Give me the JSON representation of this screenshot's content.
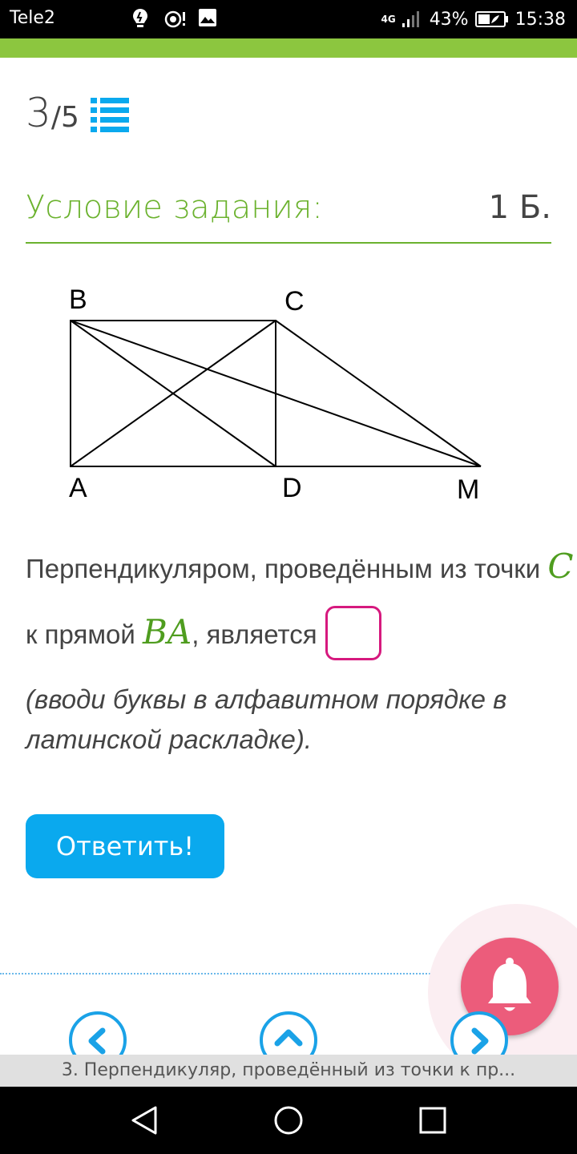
{
  "status_bar": {
    "carrier": "Tele2",
    "network": "4G",
    "battery": "43%",
    "time": "15:38"
  },
  "progress": {
    "current": "3",
    "total": "/5"
  },
  "condition": {
    "title": "Условие задания:",
    "points": "1 Б."
  },
  "figure": {
    "labels": [
      "B",
      "C",
      "A",
      "D",
      "M"
    ]
  },
  "task": {
    "line1_text": "Перпендикуляром, проведённым из точки ",
    "line1_math": "C",
    "line2_text": "к прямой ",
    "line2_math": "BA",
    "line2_tail": ", является",
    "answer_value": "",
    "hint": "(вводи буквы в алфавитном порядке в латинской раскладке)."
  },
  "answer_button": "Ответить!",
  "bottom_caption": "3. Перпендикуляр, проведённый из точки к пр...",
  "colors": {
    "accent_green": "#8cc63f",
    "title_green": "#6bb22e",
    "button_blue": "#0aa9ee",
    "answer_border": "#d6197e",
    "bell": "#ec5c7b"
  },
  "icons": {
    "list": "list-icon",
    "bell": "bell-icon",
    "prev": "chevron-left-icon",
    "up": "chevron-up-icon",
    "next": "chevron-right-icon"
  }
}
